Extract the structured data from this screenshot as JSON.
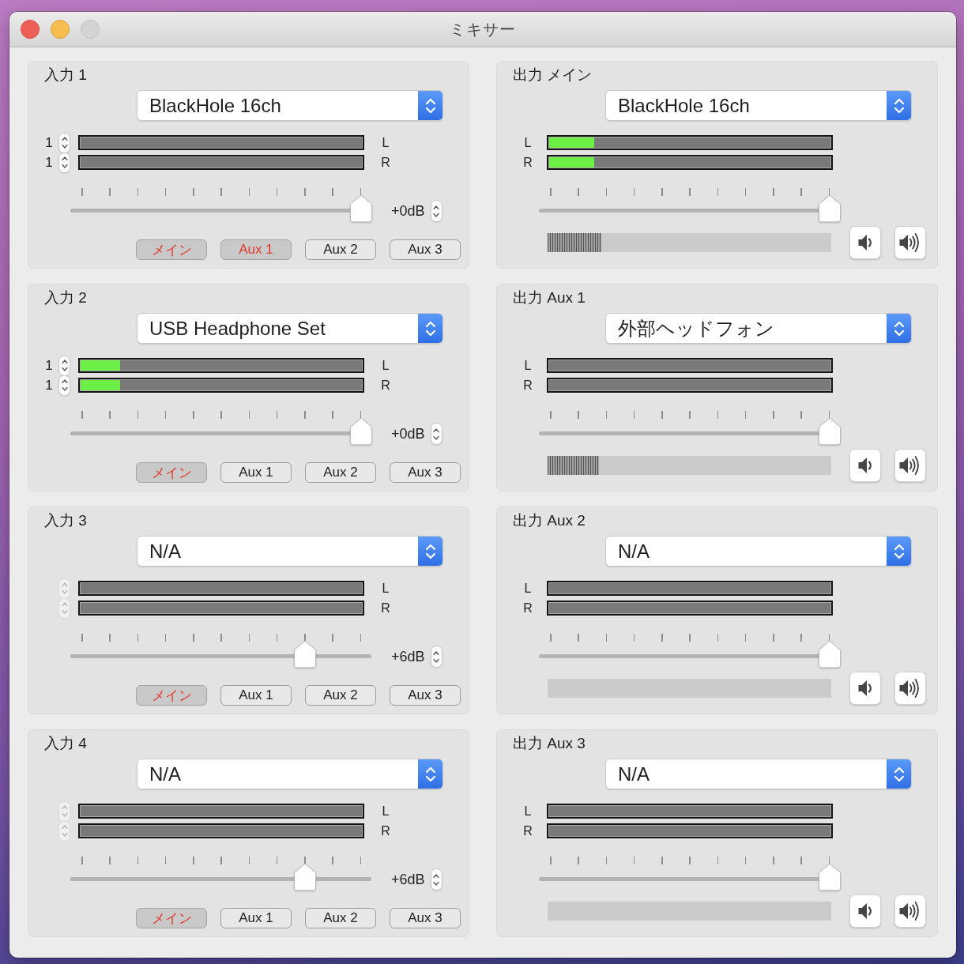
{
  "window": {
    "title": "ミキサー",
    "zoom_disabled": true
  },
  "inputs": [
    {
      "title": "入力 1",
      "device": "BlackHole 16ch",
      "channels": [
        {
          "number": "1",
          "stepper_disabled": false,
          "side": "L",
          "level": 0
        },
        {
          "number": "1",
          "stepper_disabled": false,
          "side": "R",
          "level": 0
        }
      ],
      "gain": {
        "level": 1,
        "reading": "+0dB"
      },
      "sends": [
        {
          "label": "メイン",
          "selected": true
        },
        {
          "label": "Aux 1",
          "selected": true
        },
        {
          "label": "Aux 2",
          "selected": false
        },
        {
          "label": "Aux 3",
          "selected": false
        }
      ]
    },
    {
      "title": "入力 2",
      "device": "USB Headphone Set",
      "channels": [
        {
          "number": "1",
          "stepper_disabled": false,
          "side": "L",
          "level": 0.14
        },
        {
          "number": "1",
          "stepper_disabled": false,
          "side": "R",
          "level": 0.14
        }
      ],
      "gain": {
        "level": 1,
        "reading": "+0dB"
      },
      "sends": [
        {
          "label": "メイン",
          "selected": true
        },
        {
          "label": "Aux 1",
          "selected": false
        },
        {
          "label": "Aux 2",
          "selected": false
        },
        {
          "label": "Aux 3",
          "selected": false
        }
      ]
    },
    {
      "title": "入力 3",
      "device": "N/A",
      "channels": [
        {
          "stepper_disabled": true,
          "side": "L",
          "level": 0
        },
        {
          "stepper_disabled": true,
          "side": "R",
          "level": 0
        }
      ],
      "gain": {
        "level": 0.8,
        "reading": "+6dB"
      },
      "sends": [
        {
          "label": "メイン",
          "selected": true
        },
        {
          "label": "Aux 1",
          "selected": false
        },
        {
          "label": "Aux 2",
          "selected": false
        },
        {
          "label": "Aux 3",
          "selected": false
        }
      ]
    },
    {
      "title": "入力 4",
      "device": "N/A",
      "channels": [
        {
          "stepper_disabled": true,
          "side": "L",
          "level": 0
        },
        {
          "stepper_disabled": true,
          "side": "R",
          "level": 0
        }
      ],
      "gain": {
        "level": 0.8,
        "reading": "+6dB"
      },
      "sends": [
        {
          "label": "メイン",
          "selected": true
        },
        {
          "label": "Aux 1",
          "selected": false
        },
        {
          "label": "Aux 2",
          "selected": false
        },
        {
          "label": "Aux 3",
          "selected": false
        }
      ]
    }
  ],
  "outputs": [
    {
      "title": "出力 メイン",
      "device": "BlackHole 16ch",
      "channels": [
        {
          "side": "L",
          "level": 0.16
        },
        {
          "side": "R",
          "level": 0.16
        }
      ],
      "fader": {
        "level": 1
      },
      "output_level": {
        "level": 0.19
      }
    },
    {
      "title": "出力 Aux 1",
      "device": "外部ヘッドフォン",
      "channels": [
        {
          "side": "L"
        },
        {
          "side": "R"
        }
      ],
      "fader": {
        "level": 1
      },
      "output_level": {
        "level": 0.18
      }
    },
    {
      "title": "出力 Aux 2",
      "device": "N/A",
      "channels": [
        {
          "side": "L"
        },
        {
          "side": "R"
        }
      ],
      "fader": {
        "level": 1
      }
    },
    {
      "title": "出力 Aux 3",
      "device": "N/A",
      "channels": [
        {
          "side": "L"
        },
        {
          "side": "R"
        }
      ],
      "fader": {
        "level": 1
      }
    }
  ]
}
